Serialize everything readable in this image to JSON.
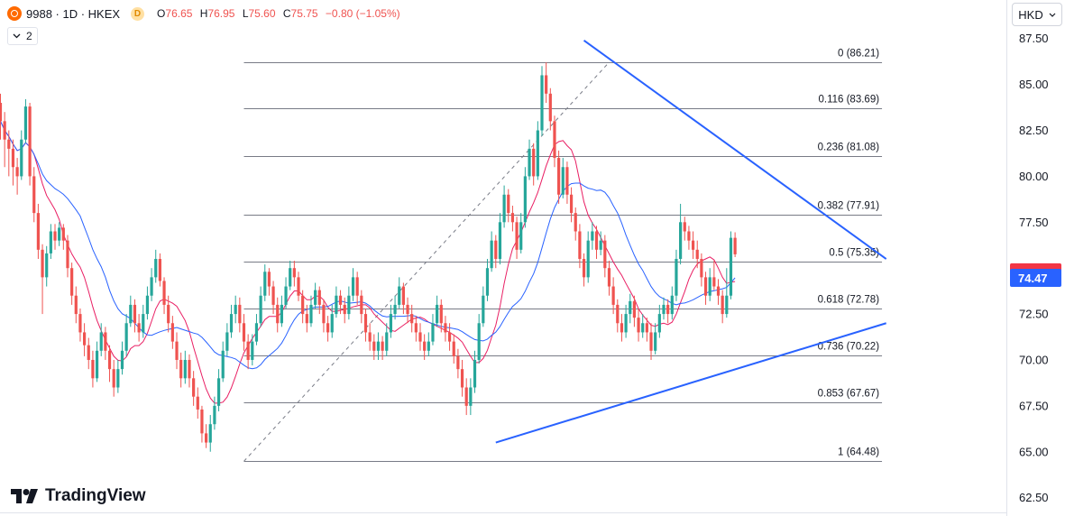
{
  "header": {
    "symbol": "9988 · 1D · HKEX",
    "badge": "D",
    "open_label": "O",
    "open": "76.65",
    "high_label": "H",
    "high": "76.95",
    "low_label": "L",
    "low": "75.60",
    "close_label": "C",
    "close": "75.75",
    "change": "−0.80 (−1.05%)",
    "indicator_count": "2"
  },
  "currency": "HKD",
  "brand": "TradingView",
  "colors": {
    "up": "#26a69a",
    "down": "#ef5350",
    "fast_ma": "#e91e63",
    "slow_ma": "#2962ff",
    "trendline": "#2962ff",
    "fib": "#787b86",
    "price_badge": "#f23645",
    "ma_badge": "#2962ff"
  },
  "chart_data": {
    "type": "candlestick",
    "y_axis": {
      "min": 61.5,
      "max": 89.6,
      "ticks": [
        "62.50",
        "65.00",
        "67.50",
        "70.00",
        "72.50",
        "75.00",
        "77.50",
        "80.00",
        "82.50",
        "85.00",
        "87.50"
      ]
    },
    "price_labels": [
      {
        "value": 74.77,
        "text": "74.77",
        "color": "#f23645"
      },
      {
        "value": 74.47,
        "text": "74.47",
        "color": "#2962ff"
      }
    ],
    "fibonacci": [
      {
        "level": "0",
        "price": 86.21,
        "label": "0 (86.21)"
      },
      {
        "level": "0.116",
        "price": 83.69,
        "label": "0.116 (83.69)"
      },
      {
        "level": "0.236",
        "price": 81.08,
        "label": "0.236 (81.08)"
      },
      {
        "level": "0.382",
        "price": 77.91,
        "label": "0.382 (77.91)"
      },
      {
        "level": "0.5",
        "price": 75.35,
        "label": "0.5 (75.35)"
      },
      {
        "level": "0.618",
        "price": 72.78,
        "label": "0.618 (72.78)"
      },
      {
        "level": "0.736",
        "price": 70.22,
        "label": "0.736 (70.22)"
      },
      {
        "level": "0.853",
        "price": 67.67,
        "label": "0.853 (67.67)"
      },
      {
        "level": "1",
        "price": 64.48,
        "label": "1 (64.48)"
      }
    ],
    "fib_range": {
      "start_bar": 58,
      "end_bar": 210
    },
    "fib_diagonal": [
      {
        "bar": 58,
        "price": 64.48
      },
      {
        "bar": 145,
        "price": 86.21
      }
    ],
    "trendlines": [
      {
        "name": "resistance",
        "from": {
          "bar": 139,
          "price": 87.4
        },
        "to": {
          "bar": 211,
          "price": 75.5
        }
      },
      {
        "name": "support",
        "from": {
          "bar": 118,
          "price": 65.5
        },
        "to": {
          "bar": 211,
          "price": 72.0
        }
      }
    ],
    "candles": [
      [
        84,
        83,
        84.5,
        82
      ],
      [
        83,
        82,
        83.5,
        80.5
      ],
      [
        82,
        81.5,
        82.5,
        80
      ],
      [
        81.5,
        80.5,
        82,
        79.5
      ],
      [
        80.5,
        80,
        81,
        79
      ],
      [
        80,
        82,
        82.5,
        79.8
      ],
      [
        82,
        83.8,
        84.2,
        81.8
      ],
      [
        83.8,
        80,
        84,
        79.5
      ],
      [
        80,
        78,
        80.5,
        77.5
      ],
      [
        78,
        76,
        78.5,
        75.5
      ],
      [
        76,
        74.5,
        76.3,
        72.5
      ],
      [
        74.5,
        75.8,
        76.2,
        74
      ],
      [
        75.8,
        77,
        77.4,
        75.5
      ],
      [
        77,
        76.5,
        77.4,
        76
      ],
      [
        76.5,
        77.2,
        77.5,
        76.2
      ],
      [
        77.2,
        76.5,
        77.4,
        76
      ],
      [
        76.5,
        75,
        76.8,
        74.5
      ],
      [
        75,
        73.5,
        75.3,
        73
      ],
      [
        73.5,
        72.5,
        74,
        72
      ],
      [
        72.5,
        71.5,
        72.8,
        71
      ],
      [
        71.5,
        70.8,
        72,
        70.2
      ],
      [
        70.8,
        70,
        71.2,
        69.5
      ],
      [
        70,
        69,
        70.5,
        68.5
      ],
      [
        69,
        70.5,
        71,
        68.8
      ],
      [
        70.5,
        71.5,
        72,
        70.2
      ],
      [
        71.5,
        70.5,
        71.8,
        70
      ],
      [
        70.5,
        69.5,
        70.8,
        68.8
      ],
      [
        69.5,
        68.5,
        70,
        68
      ],
      [
        68.5,
        69.5,
        70,
        68.2
      ],
      [
        69.5,
        70.5,
        71,
        69.2
      ],
      [
        70.5,
        72,
        72.5,
        70.2
      ],
      [
        72,
        73,
        73.5,
        71.8
      ],
      [
        73,
        72,
        73.3,
        71.5
      ],
      [
        72,
        71.5,
        72.5,
        71
      ],
      [
        71.5,
        72.5,
        73,
        71.2
      ],
      [
        72.5,
        73.5,
        74,
        72.2
      ],
      [
        73.5,
        74.5,
        75,
        73.2
      ],
      [
        74.5,
        75.5,
        76,
        74.2
      ],
      [
        75.5,
        74.3,
        75.8,
        74
      ],
      [
        74.3,
        73,
        74.5,
        72.5
      ],
      [
        73,
        72,
        73.5,
        71.5
      ],
      [
        72,
        71,
        72.4,
        70.6
      ],
      [
        71,
        70,
        71.5,
        69.5
      ],
      [
        70,
        69,
        70.4,
        68.5
      ],
      [
        69,
        70,
        70.5,
        68.7
      ],
      [
        70,
        69,
        70.3,
        68.5
      ],
      [
        69,
        68,
        69.4,
        67.5
      ],
      [
        68,
        67.3,
        68.5,
        66.8
      ],
      [
        67.3,
        66,
        67.5,
        65.5
      ],
      [
        66,
        65.5,
        66.5,
        65.2
      ],
      [
        65.5,
        66.5,
        67,
        65
      ],
      [
        66.5,
        67.5,
        68,
        66.2
      ],
      [
        67.5,
        69,
        69.5,
        67.2
      ],
      [
        69,
        70.5,
        71,
        68.8
      ],
      [
        70.5,
        71.5,
        72,
        70.2
      ],
      [
        71.5,
        72.5,
        73,
        71.2
      ],
      [
        72.5,
        73,
        73.5,
        72
      ],
      [
        73,
        72,
        73.4,
        71.5
      ],
      [
        72,
        71,
        72.5,
        70.5
      ],
      [
        71,
        70,
        71.4,
        69.5
      ],
      [
        70,
        71,
        71.4,
        69.7
      ],
      [
        71,
        72,
        72.5,
        70.8
      ],
      [
        72,
        73.5,
        74,
        71.8
      ],
      [
        73.5,
        74.8,
        75.2,
        73.2
      ],
      [
        74.8,
        74,
        75,
        73.5
      ],
      [
        74,
        73,
        74.3,
        72.5
      ],
      [
        73,
        72,
        73.4,
        71.5
      ],
      [
        72,
        73,
        73.5,
        71.8
      ],
      [
        73,
        74,
        74.5,
        72.8
      ],
      [
        74,
        75,
        75.4,
        73.8
      ],
      [
        75,
        74.5,
        75.4,
        74
      ],
      [
        74.5,
        73.5,
        74.8,
        73.2
      ],
      [
        73.5,
        72.5,
        73.8,
        72
      ],
      [
        72.5,
        72,
        73,
        71.5
      ],
      [
        72,
        73,
        73.5,
        71.8
      ],
      [
        73,
        73.8,
        74.2,
        72.8
      ],
      [
        73.8,
        73,
        74,
        72.5
      ],
      [
        73,
        72,
        73.3,
        71.5
      ],
      [
        72,
        71.5,
        72.4,
        71
      ],
      [
        71.5,
        72.5,
        73,
        71.2
      ],
      [
        72.5,
        73.5,
        74,
        72.3
      ],
      [
        73.5,
        73,
        73.8,
        72.5
      ],
      [
        73,
        72.5,
        73.4,
        72
      ],
      [
        72.5,
        73.5,
        74,
        72.2
      ],
      [
        73.5,
        74.5,
        75,
        73.2
      ],
      [
        74.5,
        73.5,
        74.8,
        73
      ],
      [
        73.5,
        72.5,
        73.8,
        72
      ],
      [
        72.5,
        71.5,
        72.8,
        71
      ],
      [
        71.5,
        71,
        72,
        70.5
      ],
      [
        71,
        70.5,
        71.4,
        70
      ],
      [
        70.5,
        71,
        71.5,
        70
      ],
      [
        71,
        70.5,
        71.3,
        70
      ],
      [
        70.5,
        71.5,
        72,
        70.2
      ],
      [
        71.5,
        72.5,
        73,
        71.2
      ],
      [
        72.5,
        73,
        73.5,
        72.2
      ],
      [
        73,
        74,
        74.5,
        72.8
      ],
      [
        74,
        73,
        74.2,
        72.5
      ],
      [
        73,
        72.5,
        73.4,
        72
      ],
      [
        72.5,
        72,
        73,
        71.5
      ],
      [
        72,
        71.5,
        72.4,
        71
      ],
      [
        71.5,
        71,
        72,
        70.5
      ],
      [
        71,
        70.5,
        71.4,
        70
      ],
      [
        70.5,
        71,
        71.5,
        70.2
      ],
      [
        71,
        72,
        72.5,
        70.8
      ],
      [
        72,
        73,
        73.5,
        71.8
      ],
      [
        73,
        72,
        73.3,
        71.5
      ],
      [
        72,
        71.5,
        72.4,
        71
      ],
      [
        71.5,
        71,
        72,
        70.5
      ],
      [
        71,
        70.2,
        71.4,
        69.8
      ],
      [
        70.2,
        69.5,
        70.6,
        69
      ],
      [
        69.5,
        68.5,
        70,
        68
      ],
      [
        68.5,
        67.5,
        69,
        67
      ],
      [
        67.5,
        68.5,
        69,
        67
      ],
      [
        68.5,
        70,
        70.5,
        68.2
      ],
      [
        70,
        72,
        72.5,
        69.8
      ],
      [
        72,
        73.5,
        74,
        71.8
      ],
      [
        73.5,
        75,
        75.5,
        73.2
      ],
      [
        75,
        76.5,
        77,
        74.8
      ],
      [
        76.5,
        75.5,
        76.8,
        75
      ],
      [
        75.5,
        77.5,
        78,
        75.2
      ],
      [
        77.5,
        79,
        79.5,
        77.2
      ],
      [
        79,
        78,
        79.3,
        77.5
      ],
      [
        78,
        77.5,
        78.4,
        77
      ],
      [
        77.5,
        76,
        77.8,
        75.5
      ],
      [
        76,
        77.5,
        78,
        75.8
      ],
      [
        77.5,
        80,
        80.5,
        77.2
      ],
      [
        80,
        81.5,
        82,
        79.8
      ],
      [
        81.5,
        80,
        81.8,
        79.5
      ],
      [
        80,
        82.5,
        83,
        79.8
      ],
      [
        82.5,
        85.5,
        86,
        82.2
      ],
      [
        85.5,
        84.5,
        86.2,
        84
      ],
      [
        84.5,
        83,
        84.8,
        82.5
      ],
      [
        83,
        81,
        83.3,
        80.5
      ],
      [
        81,
        79,
        81.4,
        78.5
      ],
      [
        79,
        80.5,
        81,
        78.8
      ],
      [
        80.5,
        79,
        80.8,
        78.5
      ],
      [
        79,
        78,
        79.4,
        77.5
      ],
      [
        78,
        77,
        78.3,
        76.5
      ],
      [
        77,
        75.5,
        77.4,
        75
      ],
      [
        75.5,
        74.5,
        75.8,
        74
      ],
      [
        74.5,
        76.5,
        77,
        74.2
      ],
      [
        76.5,
        77,
        77.5,
        76
      ],
      [
        77,
        76,
        77.3,
        75.5
      ],
      [
        76,
        76.5,
        77,
        75.7
      ],
      [
        76.5,
        75,
        76.8,
        74.5
      ],
      [
        75,
        74,
        75.4,
        73.5
      ],
      [
        74,
        73,
        74.5,
        72.5
      ],
      [
        73,
        72,
        73.3,
        71.5
      ],
      [
        72,
        71.5,
        72.5,
        71
      ],
      [
        71.5,
        72.5,
        73,
        71.2
      ],
      [
        72.5,
        73.2,
        73.6,
        72
      ],
      [
        73.2,
        72.3,
        73.5,
        71.8
      ],
      [
        72.3,
        71.5,
        72.8,
        71
      ],
      [
        71.5,
        72,
        72.5,
        71.2
      ],
      [
        72,
        71.5,
        72.3,
        71
      ],
      [
        71.5,
        70.5,
        72,
        70
      ],
      [
        70.5,
        71.5,
        72,
        70.3
      ],
      [
        71.5,
        72.5,
        73,
        71.2
      ],
      [
        72.5,
        73,
        73.4,
        72.2
      ],
      [
        73,
        72.5,
        73.3,
        72
      ],
      [
        72.5,
        73.5,
        74,
        72.2
      ],
      [
        73.5,
        75.5,
        76,
        73.2
      ],
      [
        75.5,
        77.5,
        78.5,
        75.2
      ],
      [
        77.5,
        77,
        77.8,
        76.5
      ],
      [
        77,
        76.5,
        77.3,
        76
      ],
      [
        76.5,
        76,
        77,
        75.5
      ],
      [
        76,
        75.5,
        76.5,
        75
      ],
      [
        75.5,
        74.5,
        75.8,
        74
      ],
      [
        74.5,
        73.5,
        74.8,
        73
      ],
      [
        73.5,
        74.5,
        75,
        73.2
      ],
      [
        74.5,
        74,
        75.4,
        73.8
      ],
      [
        74,
        73.5,
        74.4,
        73
      ],
      [
        73.5,
        72.5,
        73.8,
        72
      ],
      [
        72.5,
        73.5,
        75,
        72.3
      ],
      [
        73.5,
        76.65,
        77,
        73.3
      ],
      [
        76.65,
        75.75,
        76.95,
        75.6
      ]
    ],
    "series": [
      {
        "name": "",
        "period": 9,
        "color": "#e91e63"
      },
      {
        "name": "",
        "period": 20,
        "color": "#2962ff"
      }
    ]
  }
}
